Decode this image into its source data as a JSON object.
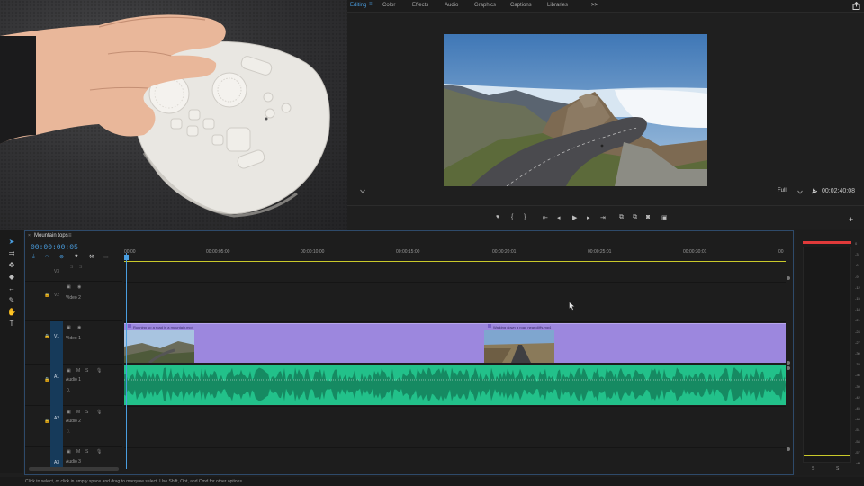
{
  "workspace": {
    "tabs": [
      {
        "label": "Editing",
        "active": true
      },
      {
        "label": "Color",
        "active": false
      },
      {
        "label": "Effects",
        "active": false
      },
      {
        "label": "Audio",
        "active": false
      },
      {
        "label": "Graphics",
        "active": false
      },
      {
        "label": "Captions",
        "active": false
      },
      {
        "label": "Libraries",
        "active": false
      }
    ],
    "overflow_icon": ">>",
    "menu_icon": "≡",
    "export_icon": "export-icon"
  },
  "program_monitor": {
    "zoom": "Full",
    "timecode": "00:02:40:08",
    "transport_icons": [
      "marker-icon",
      "in-point-icon",
      "out-point-icon",
      "go-to-in-icon",
      "step-back-icon",
      "play-icon",
      "step-forward-icon",
      "go-to-out-icon",
      "lift-icon",
      "extract-icon",
      "export-frame-icon",
      "comparison-icon"
    ],
    "add_button": "+"
  },
  "timeline": {
    "sequence_name": "Mountain tops",
    "menu_icon": "≡",
    "timecode": "00:00:00:05",
    "ruler_labels": [
      "00:00",
      "00:00:05:00",
      "00:00:10:00",
      "00:00:15:00",
      "00:00:20:01",
      "00:00:25:01",
      "00:00:30:01",
      "00"
    ],
    "tracks": {
      "v3": {
        "id": "V3",
        "name": ""
      },
      "v2": {
        "id": "V2",
        "name": "Video 2"
      },
      "v1": {
        "id": "V1",
        "name": "Video 1"
      },
      "a1": {
        "id": "A1",
        "name": "Audio 1"
      },
      "a2": {
        "id": "A2",
        "name": "Audio 2"
      },
      "a3": {
        "id": "A3",
        "name": "Audio 3"
      }
    },
    "clips": [
      {
        "title": "Running up a road in a mountain.mp4"
      },
      {
        "title": "Walking down a road near cliffs.mp4"
      }
    ],
    "audio_level_label": "0.",
    "toggle_labels": {
      "mute": "M",
      "solo": "S"
    }
  },
  "meters": {
    "scale": [
      "0",
      "-3",
      "-6",
      "-9",
      "-12",
      "-15",
      "-18",
      "-21",
      "-24",
      "-27",
      "-30",
      "-33",
      "-36",
      "-39",
      "-42",
      "-45",
      "-48",
      "-51",
      "-54",
      "-57",
      "-dB"
    ],
    "footer": [
      "S",
      "S"
    ]
  },
  "status_bar": {
    "text": "Click to select, or click in empty space and drag to marquee select. Use Shift, Opt, and Cmd for other options."
  },
  "colors": {
    "accent": "#4a9ee0",
    "video_clip": "#9c87de",
    "audio_clip": "#22c18a",
    "clip_indicator": "#e03a3a",
    "work_area": "#c9c92a"
  }
}
